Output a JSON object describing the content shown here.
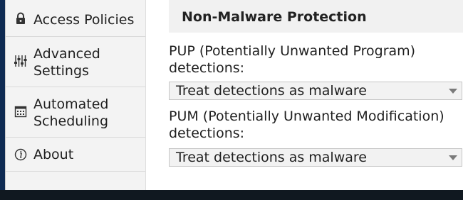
{
  "sidebar": {
    "items": [
      {
        "label": "Access Policies",
        "icon": "lock-icon"
      },
      {
        "label": "Advanced\nSettings",
        "icon": "sliders-icon"
      },
      {
        "label": "Automated\nScheduling",
        "icon": "calendar-icon"
      },
      {
        "label": "About",
        "icon": "info-icon"
      }
    ]
  },
  "main": {
    "section_title": "Non-Malware Protection",
    "pup": {
      "label": "PUP (Potentially Unwanted Program)\ndetections:",
      "selected": "Treat detections as malware"
    },
    "pum": {
      "label": "PUM (Potentially Unwanted Modification)\ndetections:",
      "selected": "Treat detections as malware"
    }
  }
}
